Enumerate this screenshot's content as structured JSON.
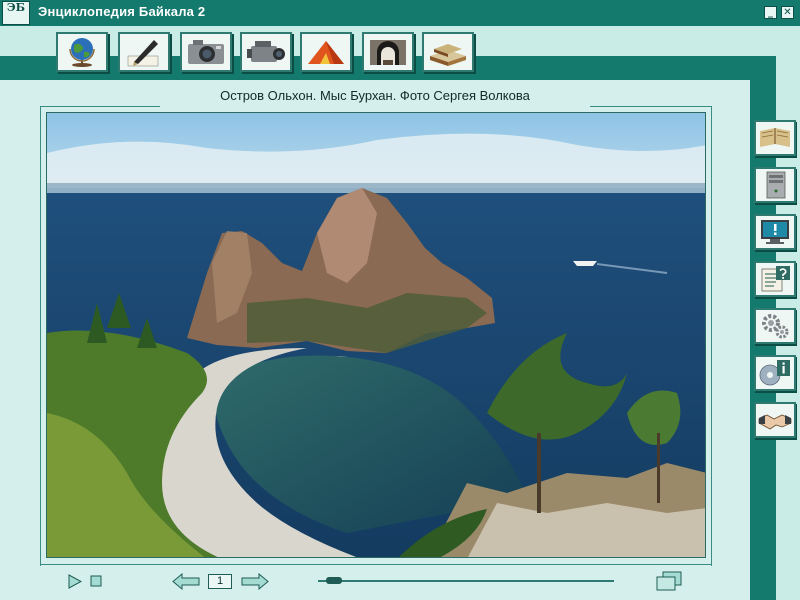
{
  "app": {
    "logo_text": "ЭБ",
    "title": "Энциклопедия Байкала 2",
    "minimize_glyph": "_",
    "close_glyph": "✕"
  },
  "toolbar": {
    "buttons": [
      {
        "name": "globe-icon"
      },
      {
        "name": "pen-icon"
      },
      {
        "name": "photo-camera-icon"
      },
      {
        "name": "video-camera-icon"
      },
      {
        "name": "tent-icon"
      },
      {
        "name": "tunnel-icon"
      },
      {
        "name": "books-icon"
      }
    ]
  },
  "sidebar": {
    "buttons": [
      {
        "name": "open-book-icon"
      },
      {
        "name": "computer-case-icon"
      },
      {
        "name": "monitor-alert-icon"
      },
      {
        "name": "help-document-icon"
      },
      {
        "name": "gears-icon"
      },
      {
        "name": "cd-info-icon"
      },
      {
        "name": "handshake-icon"
      }
    ]
  },
  "viewer": {
    "caption": "Остров Ольхон. Мыс Бурхан. Фото Сергея Волкова",
    "page": "1",
    "progress": 0.03
  },
  "colors": {
    "teal_dark": "#157a6e",
    "panel_bg": "#d5f0ec",
    "button_bg": "#eef7f4"
  }
}
